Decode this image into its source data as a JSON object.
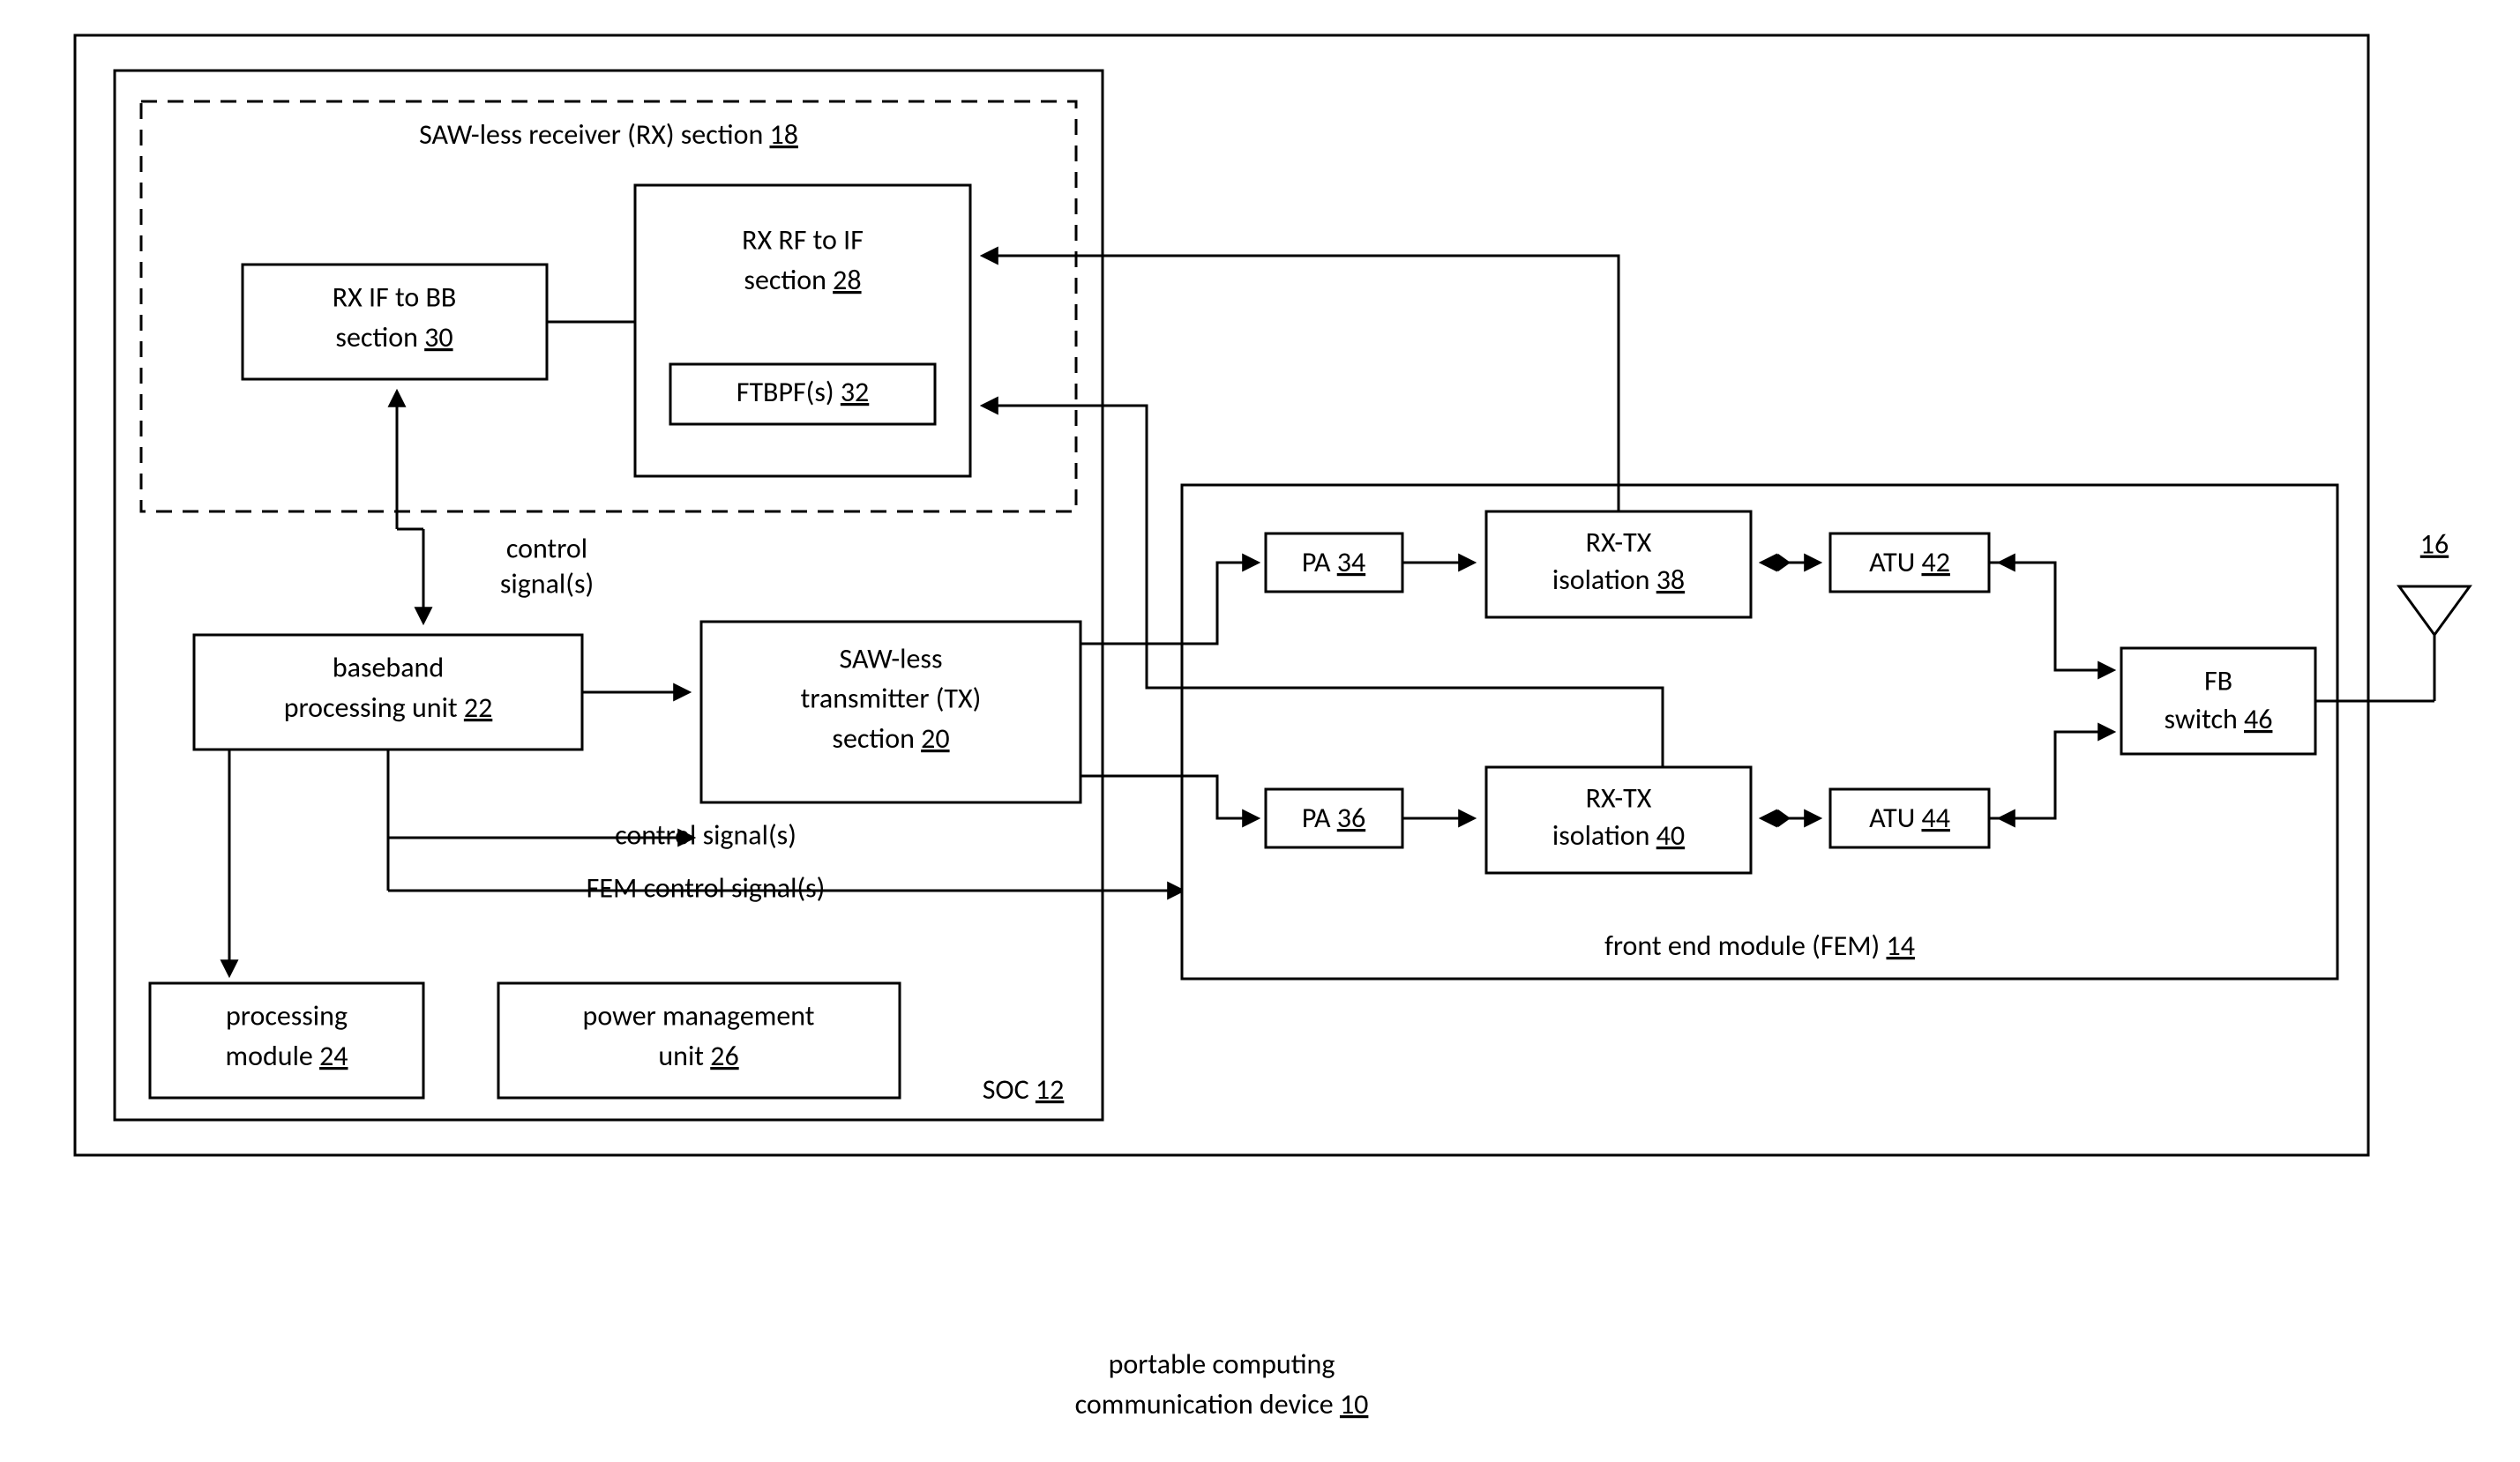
{
  "title_line1": "portable computing",
  "title_line2_pre": "communication device ",
  "title_line2_ref": "10",
  "soc_pre": "SOC ",
  "soc_ref": "12",
  "rx_sec_pre": "SAW-less receiver (RX) section ",
  "rx_sec_ref": "18",
  "rx_ifbb_line1": "RX IF to BB",
  "rx_ifbb_line2_pre": "section ",
  "rx_ifbb_line2_ref": "30",
  "rx_rf_line1": "RX RF to IF",
  "rx_rf_line2_pre": "section ",
  "rx_rf_line2_ref": "28",
  "ftbpf_pre": "FTBPF(s) ",
  "ftbpf_ref": "32",
  "bb_line1": "baseband",
  "bb_line2_pre": "processing unit ",
  "bb_line2_ref": "22",
  "tx_line1": "SAW-less",
  "tx_line2": "transmitter (TX)",
  "tx_line3_pre": "section ",
  "tx_line3_ref": "20",
  "ctrl_line1": "control",
  "ctrl_line2": "signal(s)",
  "ctrl2": "control signal(s)",
  "fem_ctrl": "FEM control signal(s)",
  "pm_line1": "processing",
  "pm_line2_pre": "module ",
  "pm_line2_ref": "24",
  "pmu_line1": "power management",
  "pmu_line2_pre": "unit ",
  "pmu_line2_ref": "26",
  "fem_pre": "front end module (FEM) ",
  "fem_ref": "14",
  "pa34_pre": "PA ",
  "pa34_ref": "34",
  "pa36_pre": "PA ",
  "pa36_ref": "36",
  "iso38_line1": "RX-TX",
  "iso38_line2_pre": "isolation ",
  "iso38_line2_ref": "38",
  "iso40_line1": "RX-TX",
  "iso40_line2_pre": "isolation ",
  "iso40_line2_ref": "40",
  "atu42_pre": "ATU ",
  "atu42_ref": "42",
  "atu44_pre": "ATU ",
  "atu44_ref": "44",
  "fb_line1": "FB",
  "fb_line2_pre": "switch ",
  "fb_line2_ref": "46",
  "ant_ref": "16"
}
